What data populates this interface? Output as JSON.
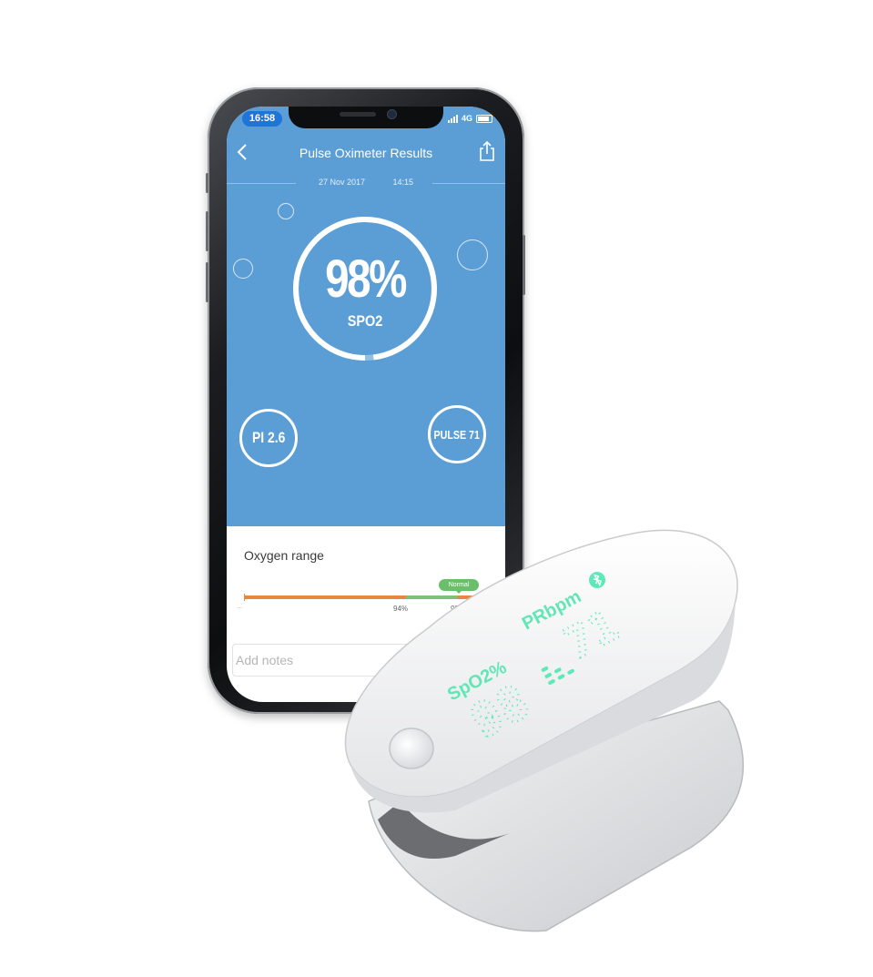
{
  "status_bar": {
    "time": "16:58",
    "network": "4G"
  },
  "header": {
    "back_icon": "chevron-left-icon",
    "title": "Pulse Oximeter Results",
    "share_icon": "share-icon"
  },
  "timestamp": {
    "date": "27 Nov 2017",
    "time": "14:15"
  },
  "spo2": {
    "value": "98%",
    "label": "SPO2",
    "level": 0.98
  },
  "pi": {
    "text": "PI 2.6"
  },
  "pulse": {
    "text": "PULSE 71"
  },
  "oxygen_range": {
    "title": "Oxygen range",
    "badge": "Normal",
    "low_label": "...",
    "mark_94": "94%",
    "mark_99": "99%"
  },
  "notes": {
    "placeholder": "Add notes"
  },
  "device": {
    "spo2_label": "SpO2%",
    "pr_label": "PRbpm",
    "spo2_reading": "98",
    "pr_reading": "71"
  },
  "colors": {
    "app_blue": "#5b9ed6",
    "status_blue": "#1f74d8",
    "range_orange": "#e8883e",
    "range_green": "#7cc27a",
    "led_green": "#5fe8b8"
  }
}
